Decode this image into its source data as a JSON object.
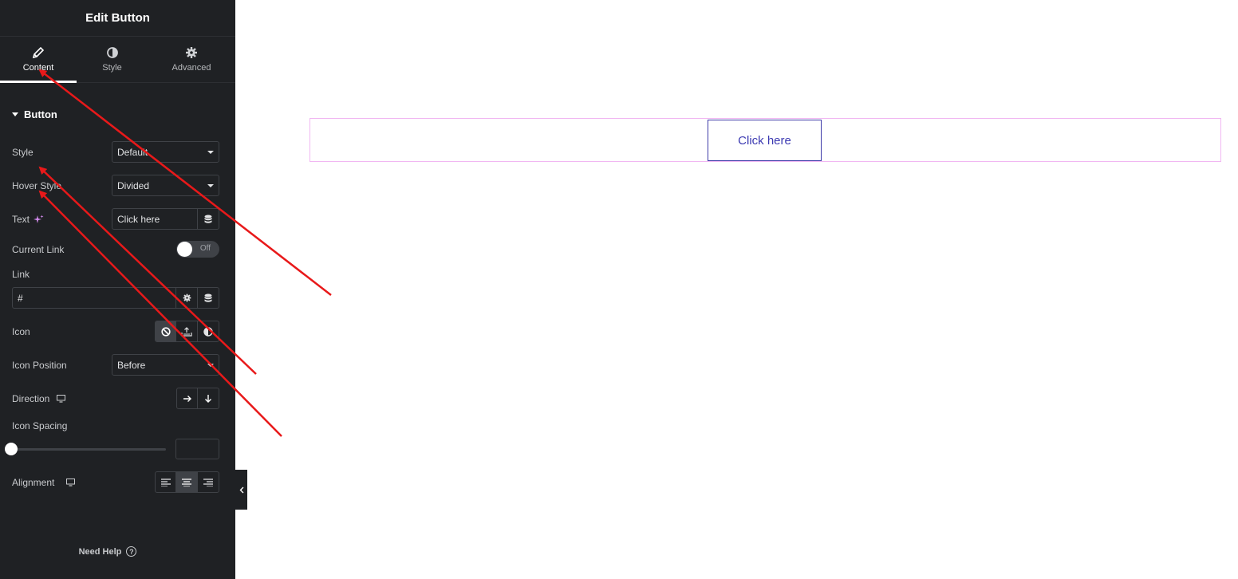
{
  "panel": {
    "title": "Edit Button",
    "tabs": [
      {
        "label": "Content",
        "icon": "pencil-icon",
        "active": true
      },
      {
        "label": "Style",
        "icon": "half-circle-icon",
        "active": false
      },
      {
        "label": "Advanced",
        "icon": "gear-icon",
        "active": false
      }
    ],
    "section_title": "Button",
    "fields": {
      "style": {
        "label": "Style",
        "value": "Default"
      },
      "hover_style": {
        "label": "Hover Style",
        "value": "Divided"
      },
      "text": {
        "label": "Text",
        "value": "Click here"
      },
      "current_link": {
        "label": "Current Link",
        "toggle_text": "Off"
      },
      "link": {
        "label": "Link",
        "value": "#"
      },
      "icon": {
        "label": "Icon",
        "options": [
          "none-icon",
          "upload-icon",
          "half-circle-icon"
        ]
      },
      "icon_position": {
        "label": "Icon Position",
        "value": "Before"
      },
      "direction": {
        "label": "Direction",
        "options": [
          "arrow-right-icon",
          "arrow-down-icon"
        ]
      },
      "icon_spacing": {
        "label": "Icon Spacing",
        "value": ""
      },
      "alignment": {
        "label": "Alignment",
        "options": [
          "align-left-icon",
          "align-center-icon",
          "align-right-icon"
        ],
        "selected": 1
      }
    },
    "help": "Need Help"
  },
  "canvas": {
    "button_text": "Click here",
    "row_border_color": "#f1b7f2",
    "button_color": "#3c3ab2"
  },
  "annotation": {
    "arrow_color": "#e8191a"
  }
}
